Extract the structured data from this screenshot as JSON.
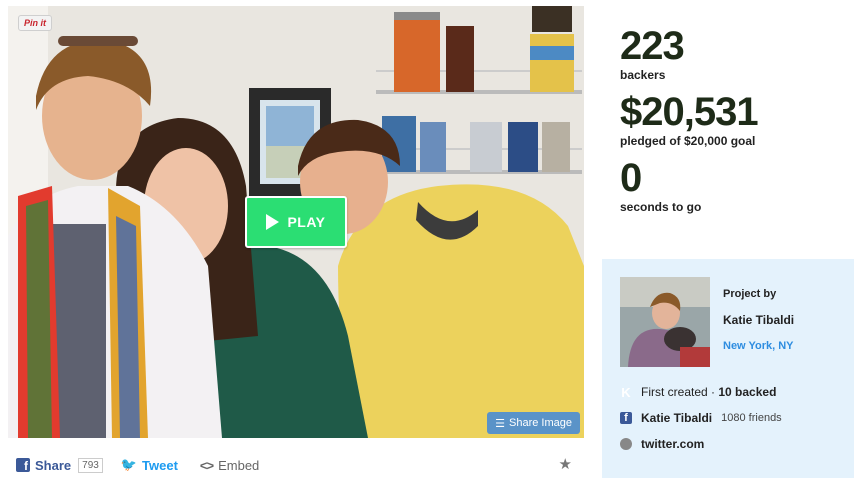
{
  "video": {
    "pinit_label": "Pin it",
    "play_label": "PLAY",
    "share_image_label": "Share Image"
  },
  "sharebar": {
    "facebook_label": "Share",
    "facebook_count": "793",
    "tweet_label": "Tweet",
    "embed_label": "Embed",
    "icons": [
      "facebook-icon",
      "twitter-icon",
      "embed-icon",
      "star-icon"
    ]
  },
  "stats": {
    "backers_count": "223",
    "backers_label": "backers",
    "pledged_amount": "$20,531",
    "pledged_label": "pledged of $20,000 goal",
    "time_count": "0",
    "time_label": "seconds to go"
  },
  "creator": {
    "project_by_label": "Project by",
    "name": "Katie Tibaldi",
    "location": "New York, NY",
    "created_label": "First created · ",
    "backed_label": "10 backed",
    "facebook_name": "Katie Tibaldi",
    "facebook_friends": "1080 friends",
    "website": "twitter.com"
  },
  "colors": {
    "play_green": "#2bde73",
    "stat_text": "#1e2b18",
    "creator_bg": "#e4f2fc",
    "link_blue": "#2e8de0",
    "facebook_blue": "#3b5998",
    "twitter_blue": "#1d9bf0"
  }
}
